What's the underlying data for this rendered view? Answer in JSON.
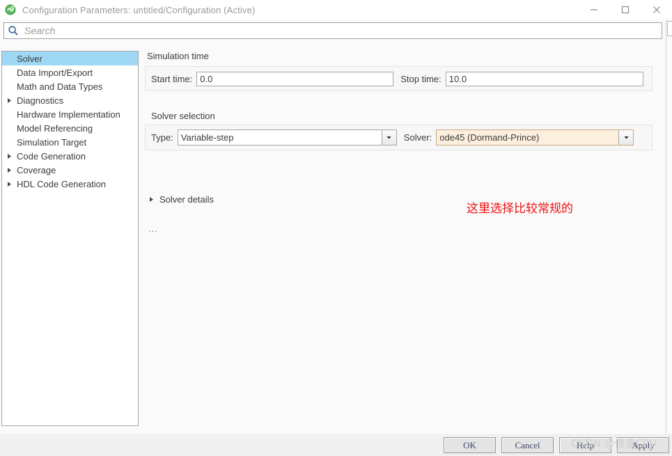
{
  "window": {
    "title": "Configuration Parameters: untitled/Configuration (Active)",
    "app_icon": "simulink-icon",
    "minimize_label": "Minimize",
    "maximize_label": "Maximize",
    "close_label": "Close"
  },
  "search": {
    "placeholder": "Search",
    "value": "",
    "icon": "search-icon"
  },
  "sidebar": {
    "items": [
      {
        "label": "Solver",
        "expandable": false,
        "selected": true
      },
      {
        "label": "Data Import/Export",
        "expandable": false,
        "selected": false
      },
      {
        "label": "Math and Data Types",
        "expandable": false,
        "selected": false
      },
      {
        "label": "Diagnostics",
        "expandable": true,
        "selected": false
      },
      {
        "label": "Hardware Implementation",
        "expandable": false,
        "selected": false
      },
      {
        "label": "Model Referencing",
        "expandable": false,
        "selected": false
      },
      {
        "label": "Simulation Target",
        "expandable": false,
        "selected": false
      },
      {
        "label": "Code Generation",
        "expandable": true,
        "selected": false
      },
      {
        "label": "Coverage",
        "expandable": true,
        "selected": false
      },
      {
        "label": "HDL Code Generation",
        "expandable": true,
        "selected": false
      }
    ]
  },
  "main": {
    "simulation_time": {
      "group_title": "Simulation time",
      "start_label": "Start time:",
      "start_value": "0.0",
      "stop_label": "Stop time:",
      "stop_value": "10.0"
    },
    "solver_selection": {
      "group_title": "Solver selection",
      "type_label": "Type:",
      "type_value": "Variable-step",
      "solver_label": "Solver:",
      "solver_value": "ode45 (Dormand-Prince)",
      "solver_highlight_color": "#fdefdd"
    },
    "solver_details_label": "Solver details",
    "ellipsis": "...",
    "annotation": {
      "text": "这里选择比较常规的",
      "color": "#f01010"
    }
  },
  "footer": {
    "ok_label": "OK",
    "cancel_label": "Cancel",
    "help_label": "Help",
    "apply_label": "Apply"
  },
  "watermark": {
    "text": "CSDN @傻童CPU"
  }
}
